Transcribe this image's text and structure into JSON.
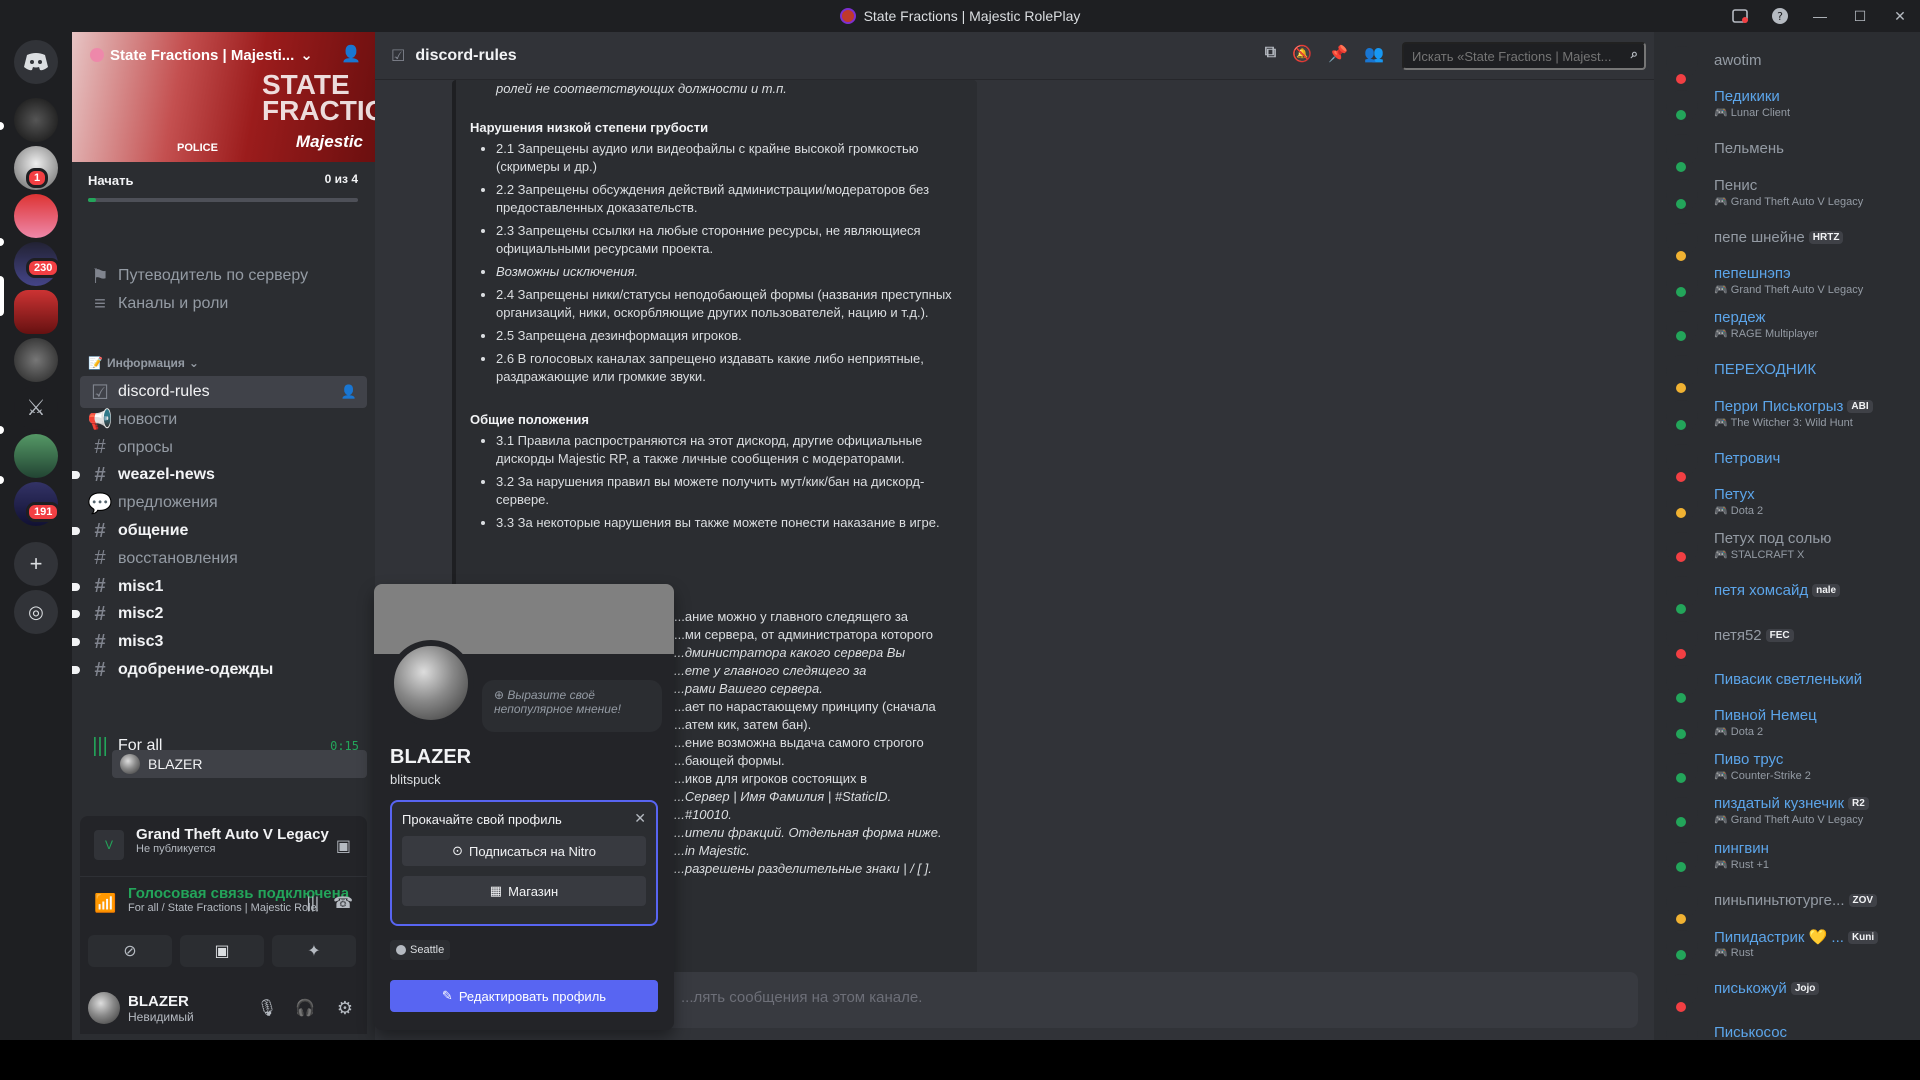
{
  "window": {
    "title": "State Fractions | Majestic RolePlay"
  },
  "servers": [
    {
      "badge": ""
    },
    {
      "badge": "1"
    },
    {
      "badge": ""
    },
    {
      "badge": "230"
    },
    {
      "badge": ""
    },
    {
      "badge": ""
    },
    {
      "badge": ""
    },
    {
      "badge": ""
    },
    {
      "badge": "191"
    }
  ],
  "server": {
    "name": "State Fractions | Majesti...",
    "banner_text": "STATE FRACTIONS",
    "banner_brand": "Majestic",
    "banner_police": "POLICE",
    "progress_label": "Начать",
    "progress_count": "0 из 4",
    "progress_fraction": 0.03
  },
  "nav": {
    "guide": "Путеводитель по серверу",
    "roles": "Каналы и роли"
  },
  "category": "Информация",
  "channels": [
    {
      "name": "discord-rules",
      "type": "rules",
      "state": "active"
    },
    {
      "name": "новости",
      "type": "announce",
      "state": "read"
    },
    {
      "name": "опросы",
      "type": "text",
      "state": "read"
    },
    {
      "name": "weazel-news",
      "type": "text",
      "state": "unread"
    },
    {
      "name": "предложения",
      "type": "forum",
      "state": "read"
    },
    {
      "name": "общение",
      "type": "text",
      "state": "unread"
    },
    {
      "name": "восстановления",
      "type": "text",
      "state": "read"
    },
    {
      "name": "misc1",
      "type": "text",
      "state": "unread"
    },
    {
      "name": "misc2",
      "type": "text",
      "state": "unread"
    },
    {
      "name": "misc3",
      "type": "text",
      "state": "unread"
    },
    {
      "name": "одобрение-одежды",
      "type": "text",
      "state": "unread"
    }
  ],
  "voice_channel": {
    "name": "For all",
    "timer": "0:15",
    "user": "BLAZER"
  },
  "activity": {
    "game": "Grand Theft Auto V Legacy",
    "status": "Не публикуется"
  },
  "voice": {
    "title": "Голосовая связь подключена",
    "sub": "For all / State Fractions | Majestic Role..."
  },
  "user": {
    "name": "BLAZER",
    "status": "Невидимый"
  },
  "chat": {
    "channel": "discord-rules",
    "search_placeholder": "Искать «State Fractions | Majest...",
    "composer_placeholder": "...лять сообщения на этом канале.",
    "top_fragment": "ролей не соответствующих должности и т.п.",
    "sections": [
      {
        "title": "Нарушения низкой степени грубости",
        "items": [
          {
            "t": "2.1 Запрещены аудио или видеофайлы с крайне высокой громкостью (скримеры и др.)",
            "i": false
          },
          {
            "t": "2.2 Запрещены обсуждения действий администрации/модераторов без предоставленных доказательств.",
            "i": false
          },
          {
            "t": "2.3 Запрещены ссылки на любые сторонние ресурсы, не являющиеся официальными ресурсами проекта.",
            "i": false
          },
          {
            "t": "Возможны исключения.",
            "i": true
          },
          {
            "t": "2.4 Запрещены ники/статусы неподобающей формы (названия преступных организаций, ники, оскорбляющие других пользователей, нацию и т.д.).",
            "i": false
          },
          {
            "t": "2.5 Запрещена дезинформация игроков.",
            "i": false
          },
          {
            "t": "2.6 В голосовых каналах запрещено издавать какие либо неприятные, раздражающие или громкие звуки.",
            "i": false
          }
        ]
      },
      {
        "title": "Общие положения",
        "items": [
          {
            "t": "3.1 Правила распространяются на этот дискорд, другие официальные дискорды Majestic RP, а также личные сообщения с модераторами.",
            "i": false
          },
          {
            "t": "3.2 За нарушения правил вы можете получить мут/кик/бан на дискорд-сервере.",
            "i": false
          },
          {
            "t": "3.3 За некоторые нарушения вы также можете понести наказание в игре.",
            "i": false
          }
        ]
      }
    ],
    "partial_lines": [
      "...ание можно у главного следящего за",
      "...ми сервера, от администратора которого",
      "...дминистратора какого сервера Вы",
      "...ете у главного следящего за",
      "...рами Вашего сервера.",
      "...ает по нарастающему принципу (сначала",
      "...атем кик, затем бан).",
      "...ение возможна выдача самого строгого",
      "...бающей формы.",
      "...иков для игроков состоящих в",
      "...Сервер | Имя Фамилия | #StaticID.",
      "...#10010.",
      "...ители фракций. Отдельная форма ниже.",
      "...in Majestic.",
      "...разрешены разделительные знаки | / [ ]."
    ]
  },
  "popout": {
    "name": "BLAZER",
    "username": "blitspuck",
    "bubble": "Выразите своё непопулярное мнение!",
    "upsell_title": "Прокачайте свой профиль",
    "nitro_btn": "Подписаться на Nitro",
    "shop_btn": "Магазин",
    "location": "Seattle",
    "edit_btn": "Редактировать профиль"
  },
  "members": [
    {
      "name": "awotim",
      "activity": "",
      "tag": "",
      "status": "dnd",
      "color": "grey"
    },
    {
      "name": "Педикики",
      "activity": "Lunar Client",
      "tag": "",
      "status": "online",
      "color": "blue"
    },
    {
      "name": "Пельмень",
      "activity": "",
      "tag": "",
      "status": "online",
      "color": "grey"
    },
    {
      "name": "Пенис",
      "activity": "Grand Theft Auto V Legacy",
      "tag": "",
      "status": "online",
      "color": "grey"
    },
    {
      "name": "пепе шнейне",
      "activity": "",
      "tag": "HRTZ",
      "status": "idle",
      "color": "grey"
    },
    {
      "name": "пепешнэпэ",
      "activity": "Grand Theft Auto V Legacy",
      "tag": "",
      "status": "online",
      "color": "blue"
    },
    {
      "name": "пердеж",
      "activity": "RAGE Multiplayer",
      "tag": "",
      "status": "online",
      "color": "blue"
    },
    {
      "name": "ПЕРЕХОДНИК",
      "activity": "",
      "tag": "",
      "status": "idle",
      "color": "blue"
    },
    {
      "name": "Перри Писькогрыз",
      "activity": "The Witcher 3: Wild Hunt",
      "tag": "ABI",
      "status": "online",
      "color": "blue"
    },
    {
      "name": "Петрович",
      "activity": "",
      "tag": "",
      "status": "dnd",
      "color": "blue"
    },
    {
      "name": "Петух",
      "activity": "Dota 2",
      "tag": "",
      "status": "idle",
      "color": "blue"
    },
    {
      "name": "Петух под солью",
      "activity": "STALCRAFT X",
      "tag": "",
      "status": "dnd",
      "color": "grey"
    },
    {
      "name": "петя хомсайд",
      "activity": "",
      "tag": "nale",
      "status": "online",
      "color": "blue"
    },
    {
      "name": "петя52",
      "activity": "",
      "tag": "FEC",
      "status": "dnd",
      "color": "grey"
    },
    {
      "name": "Пивасик светленький",
      "activity": "",
      "tag": "",
      "status": "online",
      "color": "blue"
    },
    {
      "name": "Пивной Немец",
      "activity": "Dota 2",
      "tag": "",
      "status": "online",
      "color": "blue"
    },
    {
      "name": "Пиво трус",
      "activity": "Counter-Strike 2",
      "tag": "",
      "status": "online",
      "color": "blue"
    },
    {
      "name": "пиздатый кузнечик",
      "activity": "Grand Theft Auto V Legacy",
      "tag": "R2",
      "status": "online",
      "color": "blue"
    },
    {
      "name": "пингвин",
      "activity": "Rust +1",
      "tag": "",
      "status": "online",
      "color": "blue"
    },
    {
      "name": "пиньпиньтютурге...",
      "activity": "",
      "tag": "ZOV",
      "status": "idle",
      "color": "grey"
    },
    {
      "name": "Пипидастрик 💛 ...",
      "activity": "Rust",
      "tag": "Kuni",
      "status": "online",
      "color": "blue"
    },
    {
      "name": "писькожуй",
      "activity": "",
      "tag": "Jojo",
      "status": "dnd",
      "color": "blue"
    },
    {
      "name": "Писькосос",
      "activity": "",
      "tag": "",
      "status": "dnd",
      "color": "blue"
    }
  ],
  "colors": {
    "online": "#23a55a",
    "idle": "#f0b232",
    "dnd": "#f23f43",
    "accent": "#5865f2"
  }
}
